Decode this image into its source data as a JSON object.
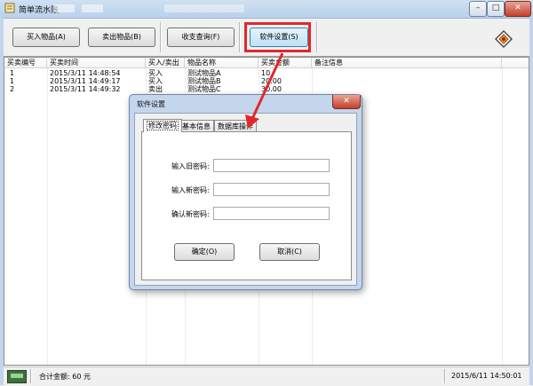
{
  "window": {
    "title": "简单流水账",
    "controls": {
      "minimize": "–",
      "maximize": "□",
      "close": "✕"
    }
  },
  "toolbar": {
    "buy_label": "买入物品(A)",
    "sell_label": "卖出物品(B)",
    "query_label": "收支查询(F)",
    "settings_label": "软件设置(S)",
    "logo_icon": "app-logo-icon"
  },
  "table": {
    "columns": [
      "买卖编号",
      "买卖时间",
      "买入/卖出",
      "物品名称",
      "买卖金额",
      "备注信息"
    ],
    "rows": [
      [
        "1",
        "2015/3/11 14:48:54",
        "买入",
        "测试物品A",
        "10",
        ""
      ],
      [
        "1",
        "2015/3/11 14:49:17",
        "买入",
        "测试物品B",
        "20.00",
        ""
      ],
      [
        "2",
        "2015/3/11 14:49:32",
        "卖出",
        "测试物品C",
        "30.00",
        ""
      ]
    ]
  },
  "status": {
    "total": "合计金额: 60 元",
    "datetime": "2015/6/11 14:50:01"
  },
  "dialog": {
    "title": "软件设置",
    "close": "✕",
    "tabs": [
      "修改密码",
      "基本信息",
      "数据库操作"
    ],
    "fields": {
      "old_password_label": "输入旧密码:",
      "new_password_label": "输入新密码:",
      "confirm_password_label": "确认新密码:"
    },
    "ok_label": "确定(O)",
    "cancel_label": "取消(C)"
  },
  "colors": {
    "highlight": "#e0282c",
    "title_bar": "#b9d1ea",
    "close_button": "#c4402c"
  }
}
